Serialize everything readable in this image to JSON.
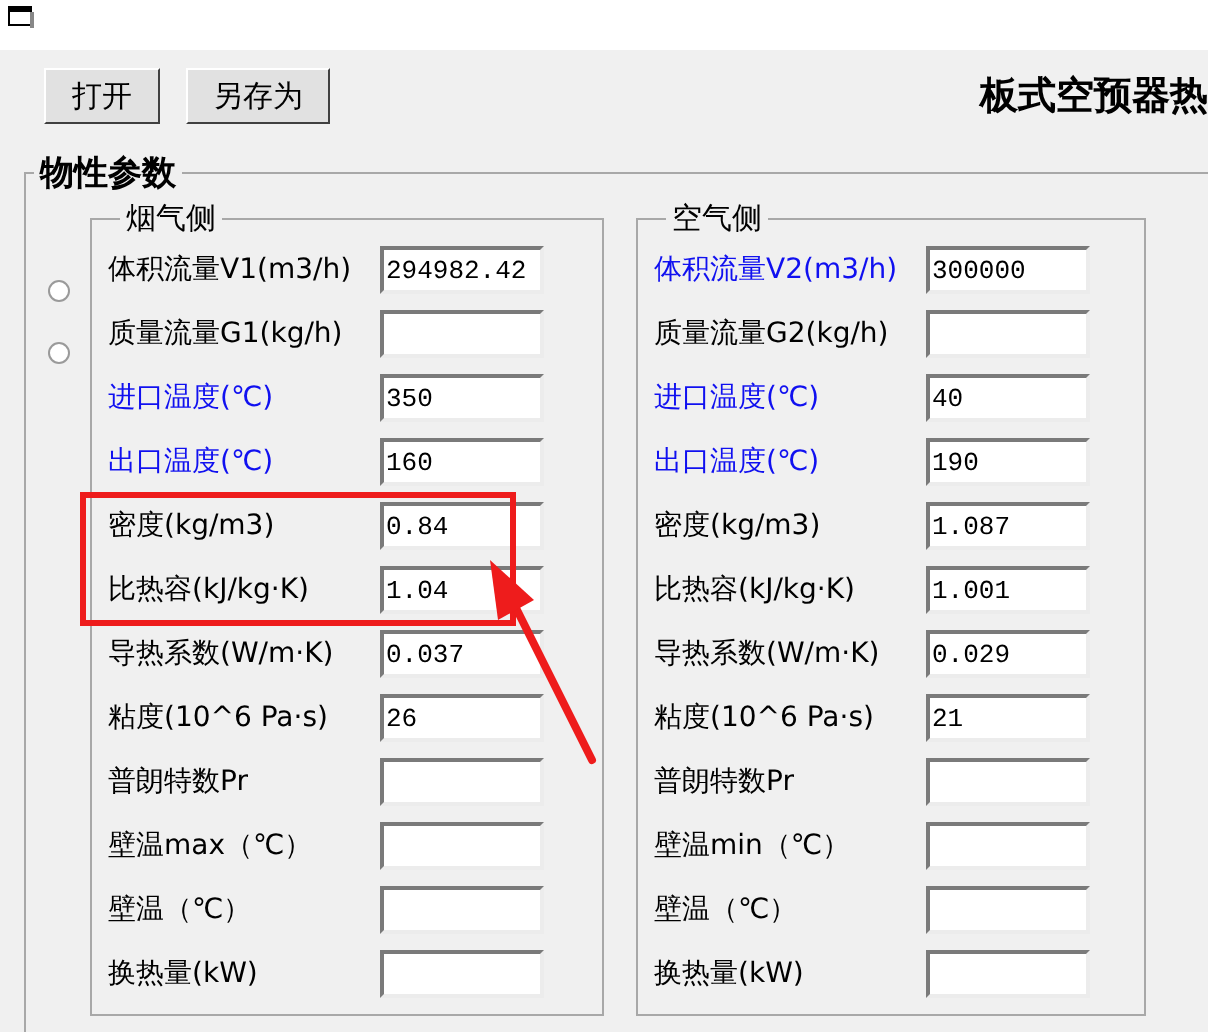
{
  "toolbar": {
    "buttons": [
      "打开",
      "另存为"
    ],
    "heading": "板式空预器热"
  },
  "properties_group": {
    "title": "物性参数",
    "radios": [
      {
        "selected": false
      },
      {
        "selected": false
      }
    ],
    "flue_side": {
      "title": "烟气侧",
      "rows": [
        {
          "label": "体积流量V1(m3/h)",
          "value": "294982.42",
          "emphasized": false
        },
        {
          "label": "质量流量G1(kg/h)",
          "emphasized": false
        },
        {
          "label": "进口温度(℃)",
          "value": "350",
          "emphasized": true
        },
        {
          "label": "出口温度(℃)",
          "value": "160",
          "emphasized": true
        },
        {
          "label": "密度(kg/m3)",
          "value": "0.84",
          "emphasized": false
        },
        {
          "label": "比热容(kJ/kg·K)",
          "value": "1.04",
          "emphasized": false
        },
        {
          "label": "导热系数(W/m·K)",
          "value": "0.037",
          "emphasized": false
        },
        {
          "label": "粘度(10^6 Pa·s)",
          "value": "26",
          "emphasized": false
        },
        {
          "label": "普朗特数Pr",
          "emphasized": false
        },
        {
          "label": "壁温max（℃）",
          "emphasized": false
        },
        {
          "label": "壁温（℃）",
          "emphasized": false
        },
        {
          "label": "换热量(kW)",
          "emphasized": false
        }
      ]
    },
    "air_side": {
      "title": "空气侧",
      "rows": [
        {
          "label": "体积流量V2(m3/h)",
          "value": "300000",
          "emphasized": true
        },
        {
          "label": "质量流量G2(kg/h)",
          "emphasized": false
        },
        {
          "label": "进口温度(℃)",
          "value": "40",
          "emphasized": true
        },
        {
          "label": "出口温度(℃)",
          "value": "190",
          "emphasized": true
        },
        {
          "label": "密度(kg/m3)",
          "value": "1.087",
          "emphasized": false
        },
        {
          "label": "比热容(kJ/kg·K)",
          "value": "1.001",
          "emphasized": false
        },
        {
          "label": "导热系数(W/m·K)",
          "value": "0.029",
          "emphasized": false
        },
        {
          "label": "粘度(10^6 Pa·s)",
          "value": "21",
          "emphasized": false
        },
        {
          "label": "普朗特数Pr",
          "emphasized": false
        },
        {
          "label": "壁温min（℃）",
          "emphasized": false
        },
        {
          "label": "壁温（℃）",
          "emphasized": false
        },
        {
          "label": "换热量(kW)",
          "emphasized": false
        }
      ]
    }
  }
}
